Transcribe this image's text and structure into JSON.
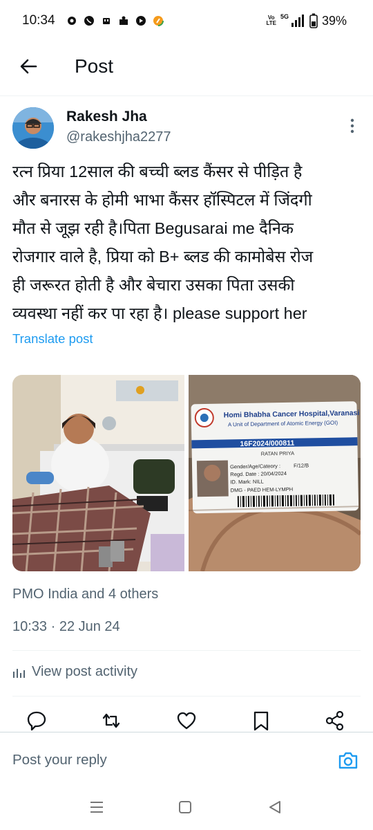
{
  "status_bar": {
    "time": "10:34",
    "volte": "Vo LTE",
    "network": "5G",
    "battery": "39%"
  },
  "header": {
    "back_icon": "arrow-left-icon",
    "title": "Post"
  },
  "post": {
    "author_name": "Rakesh Jha",
    "author_handle": "@rakeshjha2277",
    "text": "रत्न प्रिया 12साल की बच्ची ब्लड कैंसर से पीड़ित है\nऔर बनारस के होमी भाभा कैंसर हॉस्पिटल में जिंदगी\nमौत से जूझ रही है।पिता Begusarai  me दैनिक\nरोजगार वाले है, प्रिया को B+ ब्लड की कामोबेस रोज\nही जरूरत होती है और बेचारा उसका पिता उसकी\nव्यवस्था नहीं कर पा रहा है। please support her",
    "translate_label": "Translate post",
    "card": {
      "hospital": "Homi Bhabha Cancer Hospital,Varanasi",
      "unit": "A Unit of Department of Atomic Energy (GOI)",
      "number": "16F2024/000811",
      "name": "RATAN PRIYA",
      "gender_label": "Gender/Age/Cateory :",
      "gender_value": "F/12/B",
      "regd": "Regd. Date : 20/04/2024",
      "mark": "ID. Mark: NILL",
      "dmg": "DMG - PAED HEM-LYMPH"
    },
    "liked_by": "PMO India and 4 others",
    "datetime": "10:33 · 22 Jun 24",
    "view_activity": "View post activity"
  },
  "reply": {
    "placeholder": "Post your reply"
  },
  "colors": {
    "accent": "#1d9bf0",
    "secondary_text": "#536471",
    "divider": "#eff3f4"
  }
}
